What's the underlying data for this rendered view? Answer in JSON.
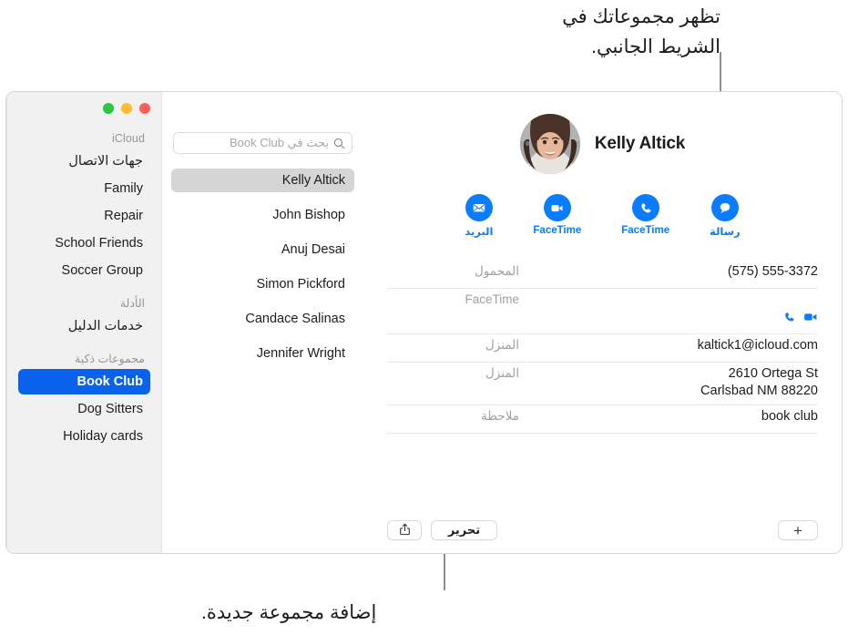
{
  "annotations": {
    "top": "تظهر مجموعاتك في\nالشريط الجانبي.",
    "bottom": "إضافة مجموعة جديدة."
  },
  "window": {
    "traffic_lights": [
      "green-button",
      "yellow-button",
      "close-button"
    ]
  },
  "sidebar": {
    "sections": [
      {
        "title": "iCloud",
        "items": [
          {
            "label": "جهات الاتصال",
            "selected": false
          },
          {
            "label": "Family",
            "selected": false
          },
          {
            "label": "Repair",
            "selected": false
          },
          {
            "label": "School Friends",
            "selected": false
          },
          {
            "label": "Soccer Group",
            "selected": false
          }
        ]
      },
      {
        "title": "الأدلة",
        "items": [
          {
            "label": "خدمات الدليل",
            "selected": false
          }
        ]
      },
      {
        "title": "مجموعات ذكية",
        "items": [
          {
            "label": "Book Club",
            "selected": true
          },
          {
            "label": "Dog Sitters",
            "selected": false
          },
          {
            "label": "Holiday cards",
            "selected": false
          }
        ]
      }
    ],
    "accent_color": "#0a61ec"
  },
  "contact_list": {
    "search": {
      "placeholder": "بحث في Book Club",
      "value": "",
      "icon": "search-icon"
    },
    "contacts": [
      {
        "name": "Kelly Altick",
        "selected": true
      },
      {
        "name": "John Bishop",
        "selected": false
      },
      {
        "name": "Anuj Desai",
        "selected": false
      },
      {
        "name": "Simon Pickford",
        "selected": false
      },
      {
        "name": "Candace Salinas",
        "selected": false
      },
      {
        "name": "Jennifer Wright",
        "selected": false
      }
    ],
    "selection_color": "#d5d5d5"
  },
  "detail": {
    "name": "Kelly Altick",
    "avatar_alt": "صورة جهة الاتصال",
    "actions": [
      {
        "label": "البريد",
        "icon": "mail-icon"
      },
      {
        "label": "FaceTime",
        "icon": "facetime-video-icon"
      },
      {
        "label": "FaceTime",
        "icon": "phone-icon"
      },
      {
        "label": "رسالة",
        "icon": "message-icon"
      }
    ],
    "action_color": "#0a7cff",
    "fields": [
      {
        "label": "المحمول",
        "value": "(575) 555-3372",
        "type": "text"
      },
      {
        "label": "FaceTime",
        "value": "",
        "type": "icons"
      },
      {
        "label": "المنزل",
        "value": "kaltick1@icloud.com",
        "type": "text"
      },
      {
        "label": "المنزل",
        "value": "2610 Ortega St\nCarlsbad NM 88220",
        "type": "text"
      },
      {
        "label": "ملاحظة",
        "value": "book club",
        "type": "text"
      }
    ],
    "buttons": {
      "share": "share-icon",
      "edit": "تحرير",
      "add": "+"
    }
  }
}
